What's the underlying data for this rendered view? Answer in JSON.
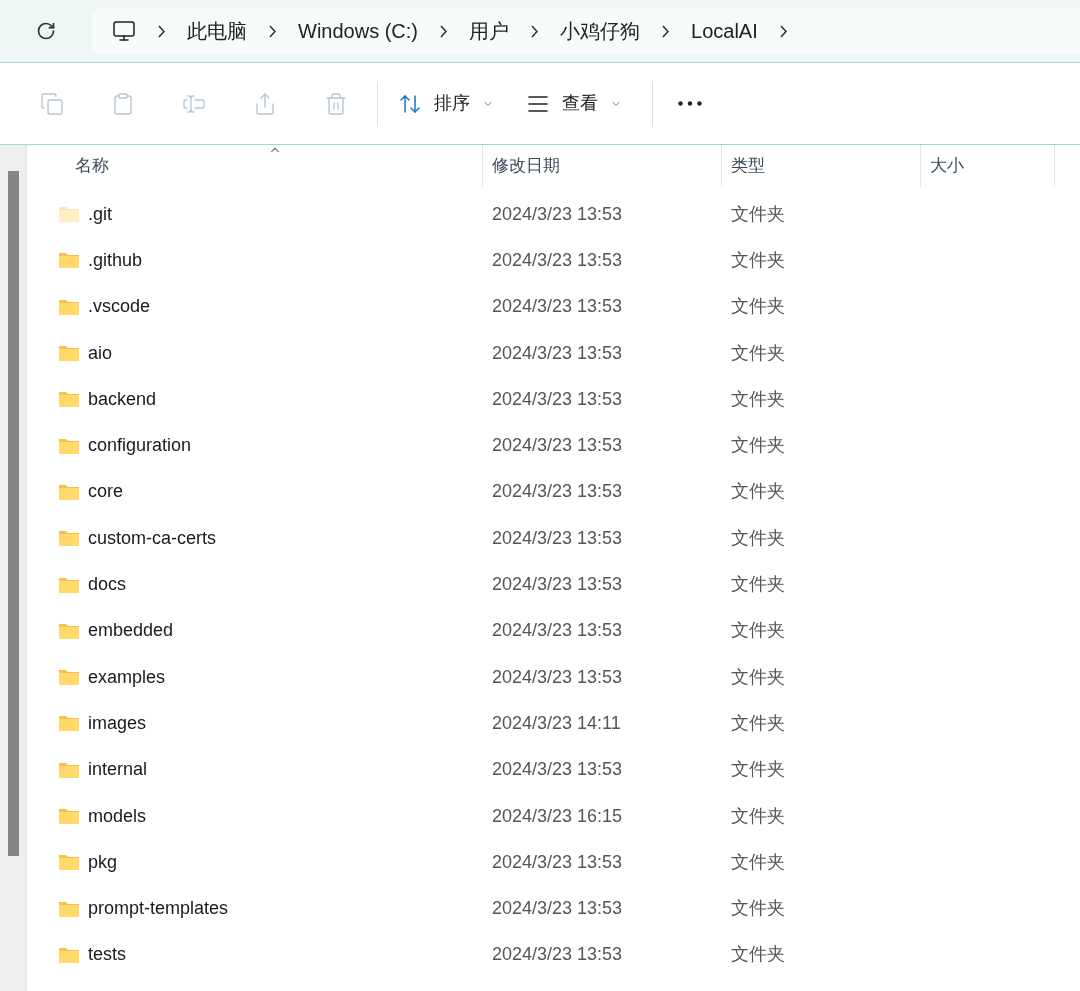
{
  "address_bar": {
    "crumbs": [
      "此电脑",
      "Windows (C:)",
      "用户",
      "小鸡仔狗",
      "LocalAI"
    ]
  },
  "toolbar": {
    "actions": [
      {
        "kind": "copy",
        "disabled": true
      },
      {
        "kind": "paste",
        "disabled": true
      },
      {
        "kind": "rename",
        "disabled": true
      },
      {
        "kind": "share",
        "disabled": true
      },
      {
        "kind": "delete",
        "disabled": true
      }
    ],
    "sort": {
      "label": "排序"
    },
    "view": {
      "label": "查看"
    }
  },
  "table": {
    "columns": [
      "名称",
      "修改日期",
      "类型",
      "大小"
    ],
    "rows": [
      {
        "name": ".git",
        "modified": "2024/3/23 13:53",
        "type": "文件夹",
        "hidden": true
      },
      {
        "name": ".github",
        "modified": "2024/3/23 13:53",
        "type": "文件夹",
        "hidden": false
      },
      {
        "name": ".vscode",
        "modified": "2024/3/23 13:53",
        "type": "文件夹",
        "hidden": false
      },
      {
        "name": "aio",
        "modified": "2024/3/23 13:53",
        "type": "文件夹",
        "hidden": false
      },
      {
        "name": "backend",
        "modified": "2024/3/23 13:53",
        "type": "文件夹",
        "hidden": false
      },
      {
        "name": "configuration",
        "modified": "2024/3/23 13:53",
        "type": "文件夹",
        "hidden": false
      },
      {
        "name": "core",
        "modified": "2024/3/23 13:53",
        "type": "文件夹",
        "hidden": false
      },
      {
        "name": "custom-ca-certs",
        "modified": "2024/3/23 13:53",
        "type": "文件夹",
        "hidden": false
      },
      {
        "name": "docs",
        "modified": "2024/3/23 13:53",
        "type": "文件夹",
        "hidden": false
      },
      {
        "name": "embedded",
        "modified": "2024/3/23 13:53",
        "type": "文件夹",
        "hidden": false
      },
      {
        "name": "examples",
        "modified": "2024/3/23 13:53",
        "type": "文件夹",
        "hidden": false
      },
      {
        "name": "images",
        "modified": "2024/3/23 14:11",
        "type": "文件夹",
        "hidden": false
      },
      {
        "name": "internal",
        "modified": "2024/3/23 13:53",
        "type": "文件夹",
        "hidden": false
      },
      {
        "name": "models",
        "modified": "2024/3/23 16:15",
        "type": "文件夹",
        "hidden": false
      },
      {
        "name": "pkg",
        "modified": "2024/3/23 13:53",
        "type": "文件夹",
        "hidden": false
      },
      {
        "name": "prompt-templates",
        "modified": "2024/3/23 13:53",
        "type": "文件夹",
        "hidden": false
      },
      {
        "name": "tests",
        "modified": "2024/3/23 13:53",
        "type": "文件夹",
        "hidden": false
      }
    ]
  }
}
